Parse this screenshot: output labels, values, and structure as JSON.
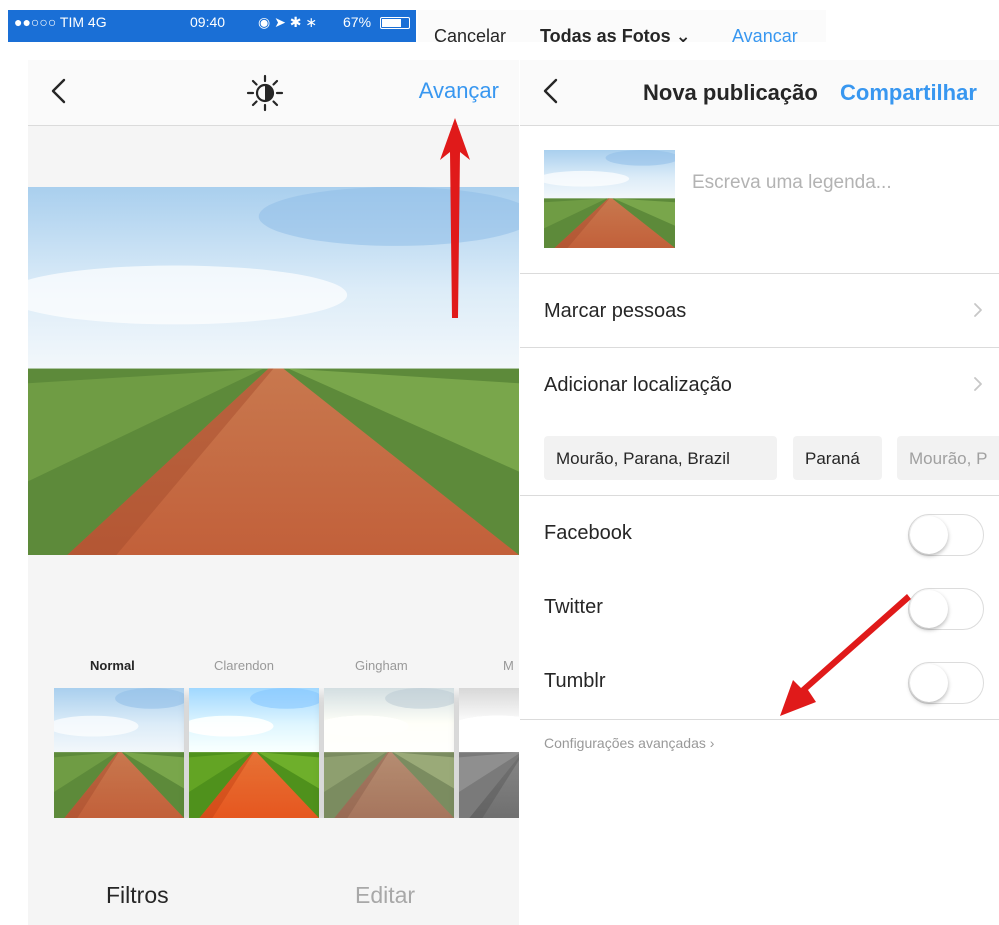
{
  "status_bar": {
    "carrier": "●●○○○ TIM  4G",
    "time": "09:40",
    "icons": "◉ ➤ ✱ ∗",
    "battery": "67%"
  },
  "top_strip": {
    "cancel_label": "Cancelar",
    "album_label": "Todas as Fotos ⌄",
    "next_label": "Avançar"
  },
  "filter_screen": {
    "next_label": "Avançar",
    "filters": [
      "Normal",
      "Clarendon",
      "Gingham",
      "M"
    ],
    "selected_filter": "Normal",
    "tabs": {
      "filters": "Filtros",
      "edit": "Editar"
    }
  },
  "post_screen": {
    "title": "Nova publicação",
    "share_label": "Compartilhar",
    "caption_placeholder": "Escreva uma legenda...",
    "tag_people": "Marcar pessoas",
    "add_location": "Adicionar localização",
    "location_suggestions": [
      "Mourão, Parana, Brazil",
      "Paraná",
      "Mourão, P"
    ],
    "share_toggles": [
      {
        "label": "Facebook",
        "on": false
      },
      {
        "label": "Twitter",
        "on": false
      },
      {
        "label": "Tumblr",
        "on": false
      }
    ],
    "advanced_settings": "Configurações avançadas"
  },
  "colors": {
    "accent_blue": "#3897f0",
    "arrow_red": "#e01a1a",
    "status_bar_blue": "#1a6fd6"
  }
}
